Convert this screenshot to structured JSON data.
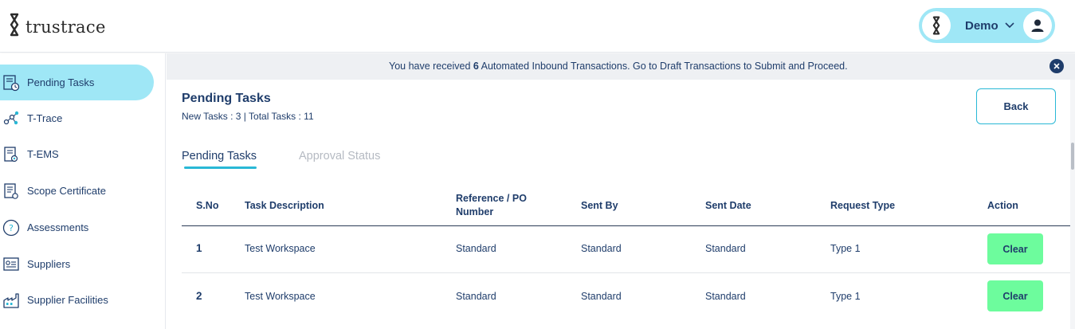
{
  "brand": {
    "name": "trustrace",
    "icon": "trustrace-logo-icon"
  },
  "user": {
    "name": "Demo",
    "chevron_icon": "chevron-down-icon",
    "avatar_icon": "user-avatar-icon"
  },
  "sidebar": {
    "items": [
      {
        "label": "Pending Tasks",
        "icon": "pending-tasks-icon",
        "active": true
      },
      {
        "label": "T-Trace",
        "icon": "t-trace-icon",
        "active": false
      },
      {
        "label": "T-EMS",
        "icon": "t-ems-icon",
        "active": false
      },
      {
        "label": "Scope Certificate",
        "icon": "scope-certificate-icon",
        "active": false
      },
      {
        "label": "Assessments",
        "icon": "assessments-icon",
        "active": false
      },
      {
        "label": "Suppliers",
        "icon": "suppliers-icon",
        "active": false
      },
      {
        "label": "Supplier Facilities",
        "icon": "supplier-facilities-icon",
        "active": false
      }
    ]
  },
  "banner": {
    "prefix": "You have received ",
    "count": "6",
    "suffix": " Automated Inbound Transactions. Go to Draft Transactions to Submit and Proceed.",
    "close_icon": "close-circle-icon"
  },
  "page": {
    "title": "Pending Tasks",
    "subtitle": "New Tasks : 3 | Total Tasks : 11",
    "back_label": "Back"
  },
  "tabs": [
    {
      "label": "Pending Tasks",
      "active": true
    },
    {
      "label": "Approval Status",
      "active": false
    }
  ],
  "table": {
    "headers": [
      "S.No",
      "Task Description",
      "Reference / PO Number",
      "Sent By",
      "Sent Date",
      "Request Type",
      "Action"
    ],
    "rows": [
      {
        "sno": "1",
        "task": "Test Workspace",
        "reference": "Standard",
        "sent_by": "Standard",
        "sent_date": "Standard",
        "request_type": "Type 1",
        "action": "Clear"
      },
      {
        "sno": "2",
        "task": "Test Workspace",
        "reference": "Standard",
        "sent_by": "Standard",
        "sent_date": "Standard",
        "request_type": "Type 1",
        "action": "Clear"
      }
    ]
  },
  "colors": {
    "accent": "#29b8d6",
    "active_bg": "#9fe7f6",
    "text": "#1f3d6b",
    "clear_button": "#6dfc9d",
    "banner_bg": "#eef0f3"
  }
}
